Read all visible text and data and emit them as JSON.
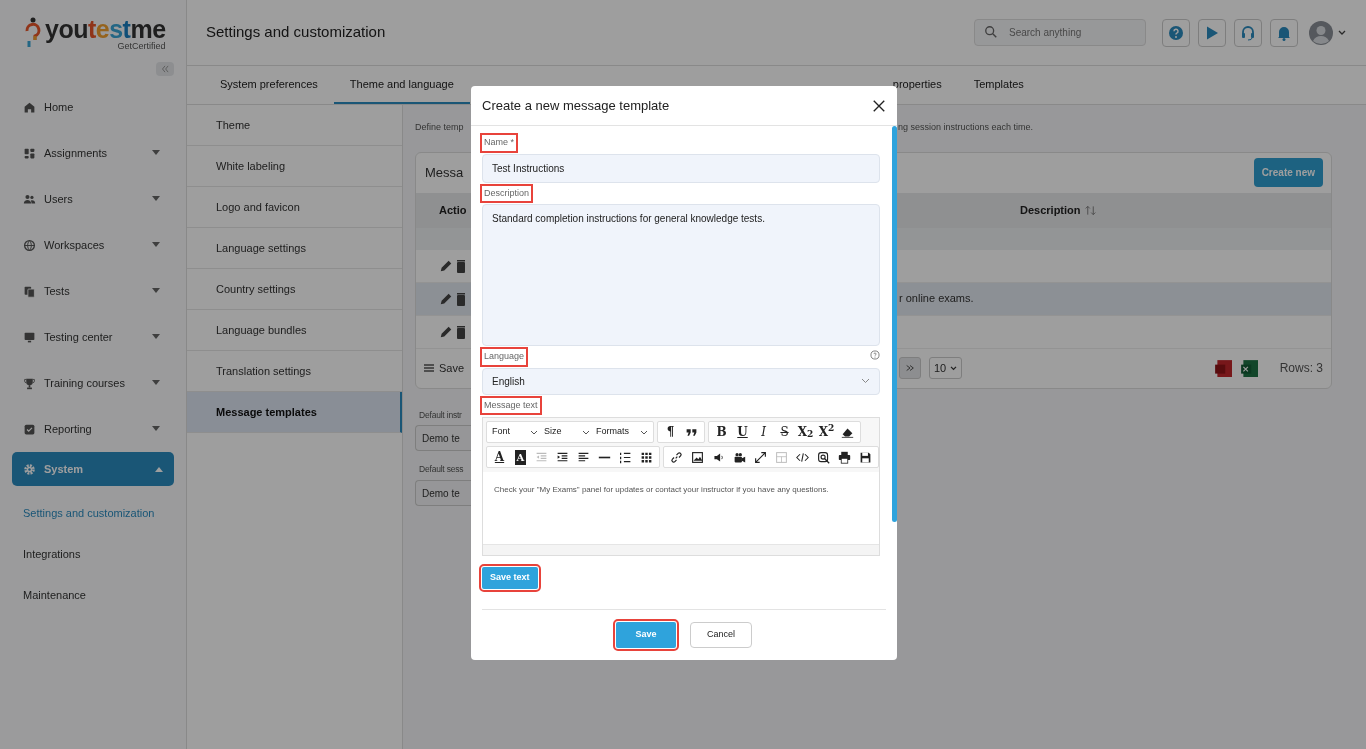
{
  "sidebar": {
    "logo": {
      "wordmark": "youtestme",
      "tagline": "GetCertified"
    },
    "items": [
      {
        "label": "Home",
        "selected": false
      },
      {
        "label": "Assignments",
        "selected": false,
        "expanded": false
      },
      {
        "label": "Users",
        "selected": false,
        "expanded": false
      },
      {
        "label": "Workspaces",
        "selected": false,
        "expanded": false
      },
      {
        "label": "Tests",
        "selected": false,
        "expanded": false
      },
      {
        "label": "Testing center",
        "selected": false,
        "expanded": false
      },
      {
        "label": "Training courses",
        "selected": false,
        "expanded": false
      },
      {
        "label": "Reporting",
        "selected": false,
        "expanded": false
      },
      {
        "label": "System",
        "selected": true,
        "expanded": true,
        "children": [
          {
            "label": "Settings and customization",
            "selected": true
          },
          {
            "label": "Integrations",
            "selected": false
          },
          {
            "label": "Maintenance",
            "selected": false
          }
        ]
      }
    ]
  },
  "header": {
    "title": "Settings and customization",
    "search": {
      "placeholder": "Search anything"
    }
  },
  "tabs": [
    {
      "label": "System preferences",
      "selected": false
    },
    {
      "label": "Theme and language",
      "selected": true
    },
    {
      "label": "properties",
      "selected": false
    },
    {
      "label": "Templates",
      "selected": false
    }
  ],
  "settings_menu": [
    {
      "label": "Theme",
      "selected": false
    },
    {
      "label": "White labeling",
      "selected": false
    },
    {
      "label": "Logo and favicon",
      "selected": false
    },
    {
      "label": "Language settings",
      "selected": false
    },
    {
      "label": "Country settings",
      "selected": false
    },
    {
      "label": "Language bundles",
      "selected": false
    },
    {
      "label": "Translation settings",
      "selected": false
    },
    {
      "label": "Message templates",
      "selected": true
    }
  ],
  "content": {
    "intro_start": "Define temp",
    "intro_end": "ng session instructions each time.",
    "card": {
      "title": "Messa",
      "create_button": "Create new",
      "columns": [
        "Actio",
        "Description"
      ],
      "rows": [
        {
          "selected": false
        },
        {
          "description": "r online exams.",
          "selected": true
        },
        {
          "selected": false
        }
      ],
      "footer": {
        "save_label": "Save",
        "page_size": "10",
        "rows_count": "Rows: 3"
      }
    },
    "defaults": [
      {
        "label": "Default instr",
        "value": "Demo te"
      },
      {
        "label": "Default sess",
        "value": "Demo te"
      }
    ]
  },
  "modal": {
    "title": "Create a new message template",
    "fields": [
      {
        "kind": "text",
        "label": "Name *",
        "value": "Test Instructions",
        "highlighted": true,
        "help": false
      },
      {
        "kind": "textarea",
        "label": "Description",
        "value": "Standard completion instructions for general knowledge tests.",
        "highlighted": true,
        "help": false
      },
      {
        "kind": "select",
        "label": "Language",
        "value": "English",
        "highlighted": true,
        "help": true
      },
      {
        "kind": "editor",
        "label": "Message text",
        "highlighted": true,
        "help": false,
        "content": "Check your \"My Exams\" panel for updates or contact your instructor if you have any questions.",
        "toolbar": [
          [
            {
              "kind": "dropdown",
              "label": "Font"
            },
            {
              "kind": "dropdown",
              "label": "Size"
            },
            {
              "kind": "dropdown",
              "label": "Formats"
            }
          ],
          [
            {
              "kind": "glyph",
              "label": "¶"
            },
            {
              "kind": "icon",
              "disabled": false
            }
          ],
          [
            {
              "kind": "bold",
              "label": "B"
            },
            {
              "kind": "underline",
              "label": "U"
            },
            {
              "kind": "italic",
              "label": "I"
            },
            {
              "kind": "strike",
              "label": "S"
            },
            {
              "kind": "rich",
              "label": "X$_{2}$"
            },
            {
              "kind": "rich",
              "label": "X$^{2}$"
            },
            {
              "kind": "icon",
              "disabled": false
            }
          ],
          [
            {
              "kind": "underline",
              "label": "A"
            },
            {
              "kind": "inverse",
              "label": "A"
            },
            {
              "kind": "icon",
              "disabled": true
            },
            {
              "kind": "icon",
              "disabled": false
            },
            {
              "kind": "icon",
              "disabled": false
            },
            {
              "kind": "icon",
              "disabled": false
            },
            {
              "kind": "icon",
              "disabled": false
            },
            {
              "kind": "icon",
              "disabled": false
            }
          ],
          [
            {
              "kind": "icon",
              "disabled": false
            },
            {
              "kind": "icon",
              "disabled": false
            },
            {
              "kind": "icon",
              "disabled": false
            },
            {
              "kind": "icon",
              "disabled": false
            },
            {
              "kind": "icon",
              "disabled": false
            },
            {
              "kind": "icon",
              "disabled": true
            },
            {
              "kind": "icon",
              "disabled": false
            },
            {
              "kind": "icon",
              "disabled": false
            },
            {
              "kind": "icon",
              "disabled": false
            },
            {
              "kind": "icon",
              "disabled": false
            }
          ]
        ]
      }
    ],
    "save_text_button": {
      "label": "Save text",
      "highlighted": true
    },
    "buttons": [
      {
        "label": "Save",
        "kind": "primary",
        "highlighted": true
      },
      {
        "label": "Cancel",
        "kind": "secondary",
        "highlighted": false
      }
    ]
  }
}
